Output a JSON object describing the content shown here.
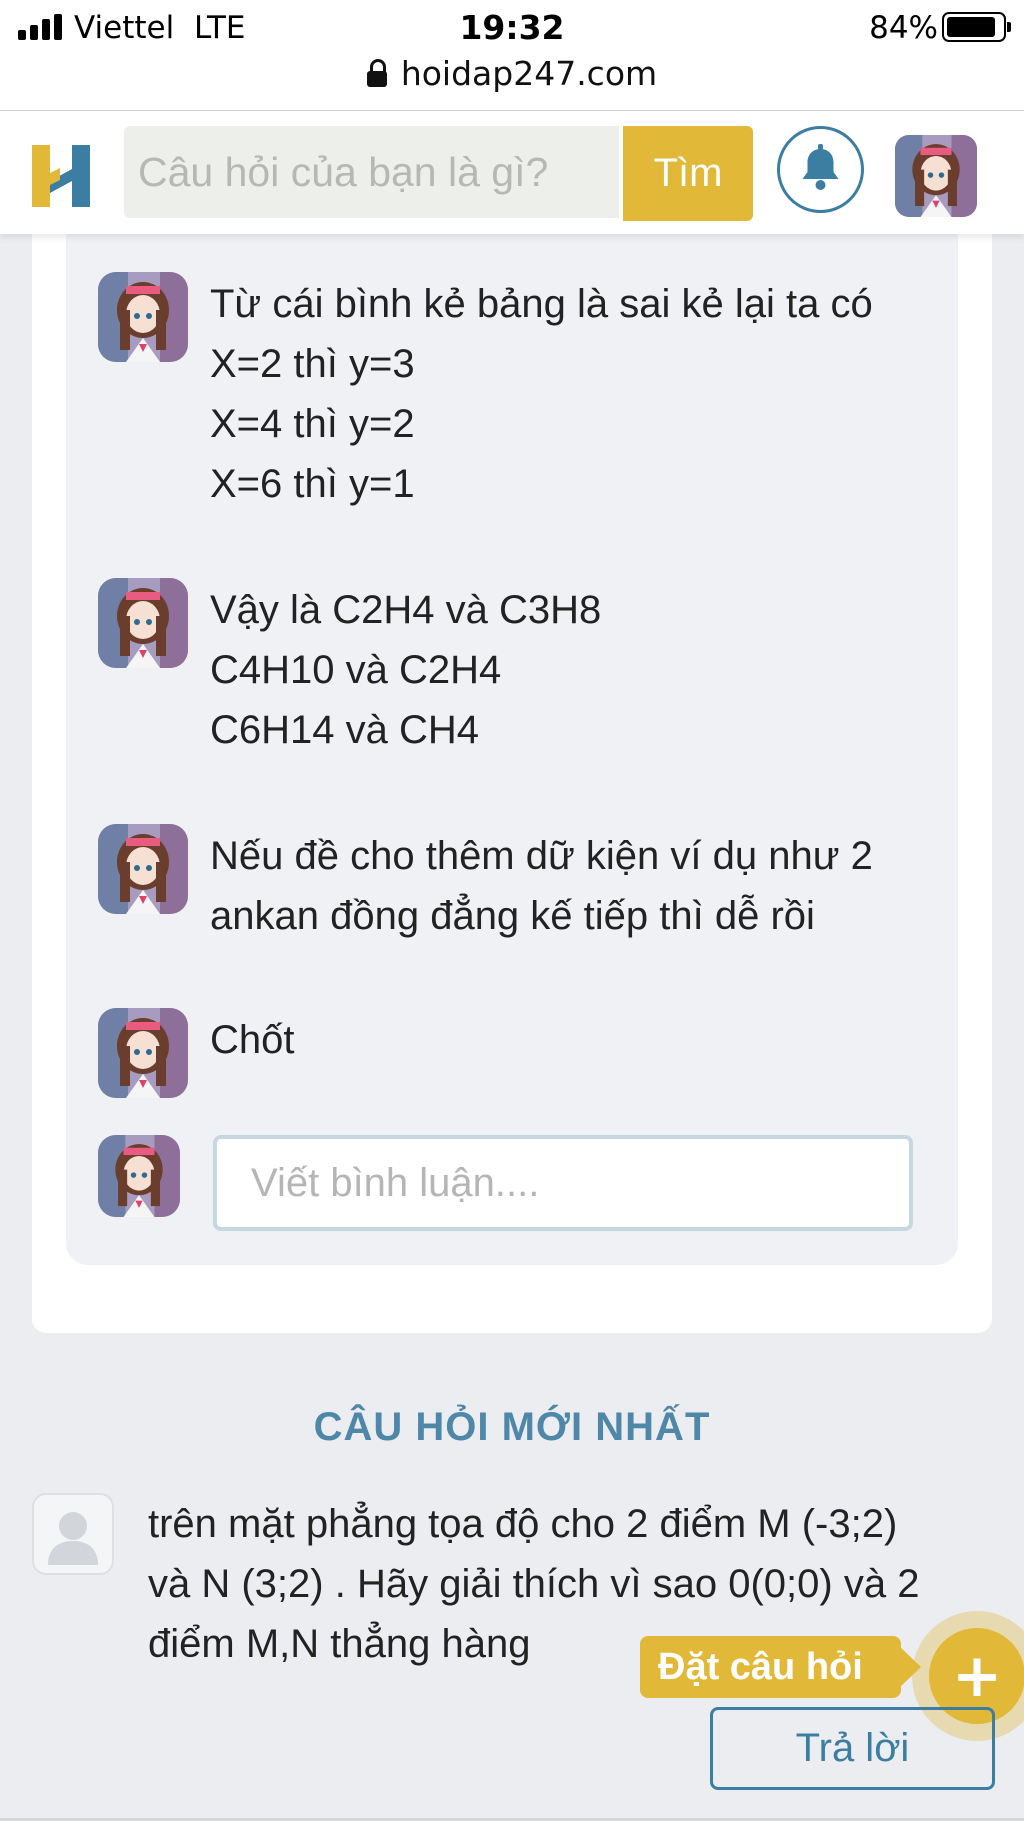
{
  "status_bar": {
    "carrier": "Viettel",
    "network": "LTE",
    "time": "19:32",
    "battery": "84%",
    "url": "hoidap247.com"
  },
  "header": {
    "logo_letter": "H",
    "search_placeholder": "Câu hỏi của bạn là gì?",
    "search_button": "Tìm",
    "icons": [
      "bell-icon",
      "user-avatar"
    ],
    "colors": {
      "accent": "#e2b838",
      "primary": "#3b7ea1"
    }
  },
  "comments": [
    {
      "lines": [
        "Từ cái bình kẻ bảng là sai kẻ lại ta có",
        "X=2 thì y=3",
        "X=4 thì y=2",
        "X=6 thì y=1"
      ]
    },
    {
      "lines": [
        "Vậy là C2H4 và C3H8",
        "C4H10 và C2H4",
        "C6H14 và CH4"
      ]
    },
    {
      "lines": [
        "Nếu đề cho thêm dữ kiện ví dụ như 2",
        "ankan đồng đẳng kế tiếp thì dễ rồi"
      ]
    },
    {
      "lines": [
        "Chốt"
      ]
    }
  ],
  "comment_input": {
    "placeholder": "Viết bình luận...."
  },
  "latest": {
    "title": "CÂU HỎI MỚI NHẤT",
    "question_lines": [
      "trên mặt phẳng tọa độ cho 2 điểm M (-3;2)",
      "và N (3;2) . Hãy giải thích vì sao 0(0;0) và 2",
      "điểm M,N thẳng hàng"
    ],
    "ask_label": "Đặt câu hỏi",
    "ask_icon": "+",
    "answer_button": "Trả lời"
  }
}
